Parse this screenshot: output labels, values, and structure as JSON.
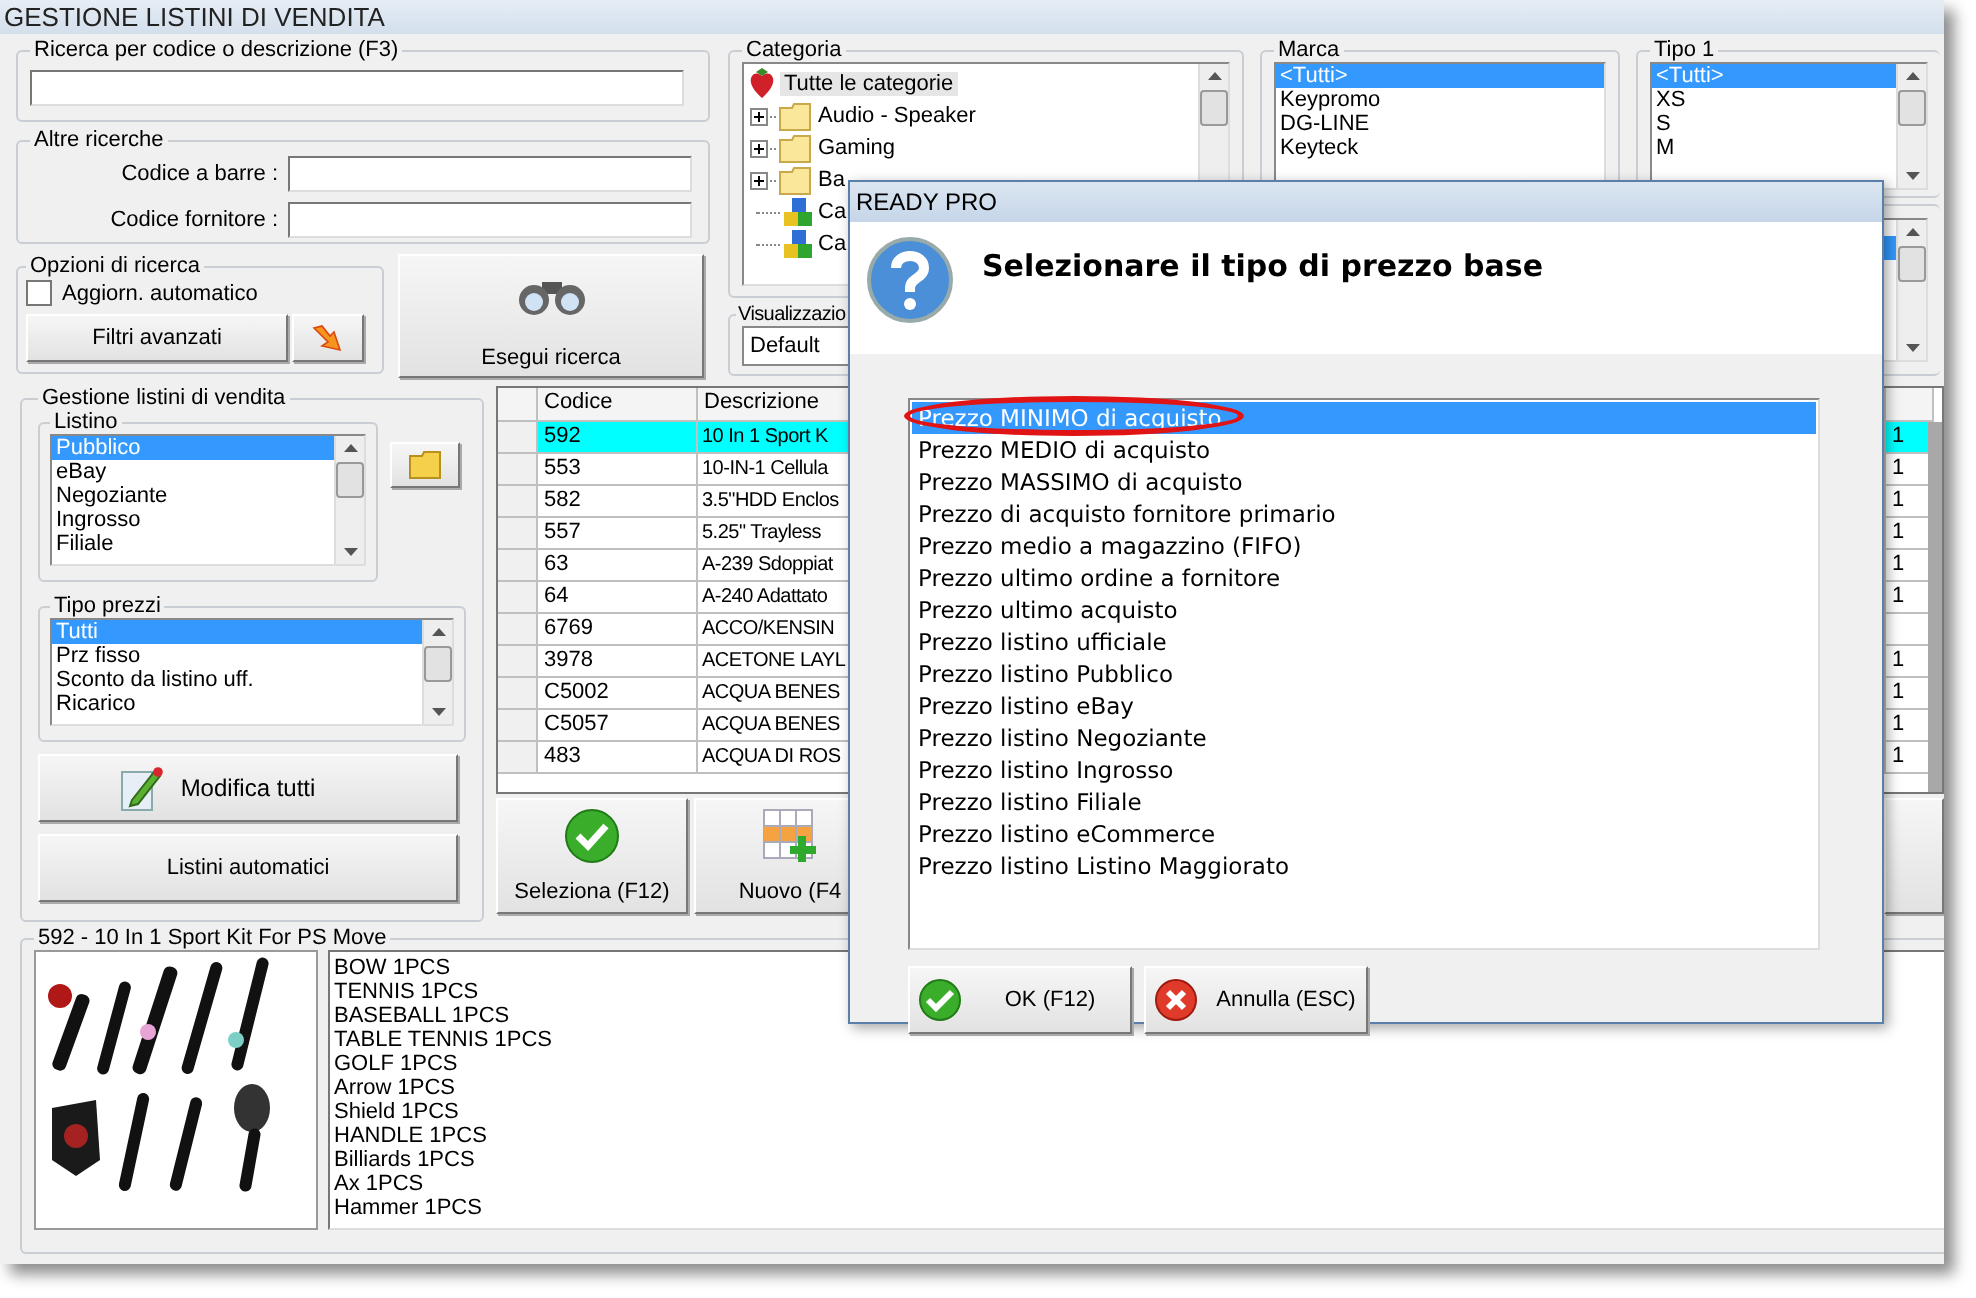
{
  "window": {
    "title": "GESTIONE LISTINI DI VENDITA"
  },
  "search": {
    "label": "Ricerca per codice o descrizione (F3)"
  },
  "other_searches": {
    "label": "Altre ricerche",
    "fields": [
      {
        "label": "Codice a barre :"
      },
      {
        "label": "Codice fornitore :"
      }
    ]
  },
  "search_options": {
    "label": "Opzioni di ricerca",
    "auto_update": {
      "label": "Aggiorn. automatico",
      "checked": false
    },
    "advanced_button": "Filtri avanzati"
  },
  "run_search_button": "Esegui ricerca",
  "category": {
    "label": "Categoria",
    "tree": [
      {
        "label": "Tutte le categorie",
        "kind": "root",
        "selected": true,
        "children": [
          {
            "label": "Audio - Speaker",
            "kind": "folder",
            "expanded": false,
            "selected": false
          },
          {
            "label": "Gaming",
            "kind": "folder",
            "expanded": false,
            "selected": false
          },
          {
            "label": "Ba",
            "kind": "folder",
            "expanded": false,
            "selected": false
          },
          {
            "label": "Ca",
            "kind": "cubes",
            "selected": false
          },
          {
            "label": "Ca",
            "kind": "cubes",
            "selected": false
          }
        ]
      }
    ]
  },
  "view": {
    "label": "Visualizzazio",
    "value": "Default"
  },
  "brand": {
    "label": "Marca",
    "items": [
      {
        "label": "<Tutti>",
        "selected": true
      },
      {
        "label": "Keypromo",
        "selected": false
      },
      {
        "label": "DG-LINE",
        "selected": false
      },
      {
        "label": "Keyteck",
        "selected": false
      }
    ]
  },
  "type_1": {
    "label": "Tipo 1",
    "items": [
      {
        "label": "<Tutti>",
        "selected": true
      },
      {
        "label": "XS",
        "selected": false
      },
      {
        "label": "S",
        "selected": false
      },
      {
        "label": "M",
        "selected": false
      }
    ]
  },
  "price_lists": {
    "label": "Gestione listini di vendita",
    "listino": {
      "label": "Listino",
      "items": [
        {
          "label": "Pubblico",
          "selected": true
        },
        {
          "label": "eBay",
          "selected": false
        },
        {
          "label": "Negoziante",
          "selected": false
        },
        {
          "label": "Ingrosso",
          "selected": false
        },
        {
          "label": "Filiale",
          "selected": false
        }
      ]
    },
    "price_types": {
      "label": "Tipo prezzi",
      "items": [
        {
          "label": "Tutti",
          "selected": true
        },
        {
          "label": "Prz fisso",
          "selected": false
        },
        {
          "label": "Sconto da listino uff.",
          "selected": false
        },
        {
          "label": "Ricarico",
          "selected": false
        }
      ]
    },
    "edit_all_button": "Modifica tutti",
    "auto_lists_button": "Listini automatici"
  },
  "table": {
    "columns": [
      "Codice",
      "Descrizione"
    ],
    "rows": [
      {
        "code": "592",
        "description": "10 In 1 Sport K",
        "column_4": "1",
        "selected": true
      },
      {
        "code": "553",
        "description": "10-IN-1 Cellula",
        "column_4": "1",
        "selected": false
      },
      {
        "code": "582",
        "description": "3.5\"HDD Enclos",
        "column_4": "1",
        "selected": false
      },
      {
        "code": "557",
        "description": "5.25\" Trayless",
        "column_4": "1",
        "selected": false
      },
      {
        "code": "63",
        "description": "A-239 Sdoppiat",
        "column_4": "1",
        "selected": false
      },
      {
        "code": "64",
        "description": "A-240 Adattato",
        "column_4": "1",
        "selected": false
      },
      {
        "code": "6769",
        "description": "ACCO/KENSIN",
        "column_4": "",
        "selected": false
      },
      {
        "code": "3978",
        "description": "ACETONE LAYL",
        "column_4": "1",
        "selected": false
      },
      {
        "code": "C5002",
        "description": "ACQUA BENES",
        "column_4": "1",
        "selected": false
      },
      {
        "code": "C5057",
        "description": "ACQUA BENES",
        "column_4": "1",
        "selected": false
      },
      {
        "code": "483",
        "description": "ACQUA DI ROS",
        "column_4": "1",
        "selected": false
      }
    ]
  },
  "buttons": [
    {
      "label": "Seleziona (F12)",
      "kind": "select"
    },
    {
      "label": "Nuovo (F4",
      "kind": "new"
    }
  ],
  "product": {
    "title": "592 - 10 In 1 Sport Kit For PS Move",
    "notes": [
      "BOW 1PCS",
      "TENNIS 1PCS",
      "BASEBALL 1PCS",
      "TABLE TENNIS 1PCS",
      "GOLF 1PCS",
      "Arrow 1PCS",
      "Shield 1PCS",
      "HANDLE 1PCS",
      "Billiards 1PCS",
      "Ax  1PCS",
      "Hammer 1PCS"
    ]
  },
  "dialog": {
    "title": "READY PRO",
    "message": "Selezionare il tipo di prezzo base",
    "options": [
      {
        "label": "Prezzo MINIMO di acquisto",
        "selected": true,
        "circled": true
      },
      {
        "label": "Prezzo MEDIO di acquisto",
        "selected": false,
        "circled": false
      },
      {
        "label": "Prezzo MASSIMO di acquisto",
        "selected": false,
        "circled": false
      },
      {
        "label": "Prezzo di acquisto fornitore primario",
        "selected": false,
        "circled": false
      },
      {
        "label": "Prezzo medio a magazzino (FIFO)",
        "selected": false,
        "circled": false
      },
      {
        "label": "Prezzo ultimo ordine a fornitore",
        "selected": false,
        "circled": false
      },
      {
        "label": "Prezzo ultimo acquisto",
        "selected": false,
        "circled": false
      },
      {
        "label": "Prezzo listino ufficiale",
        "selected": false,
        "circled": false
      },
      {
        "label": "Prezzo listino Pubblico",
        "selected": false,
        "circled": false
      },
      {
        "label": "Prezzo listino eBay",
        "selected": false,
        "circled": false
      },
      {
        "label": "Prezzo listino Negoziante",
        "selected": false,
        "circled": false
      },
      {
        "label": "Prezzo listino Ingrosso",
        "selected": false,
        "circled": false
      },
      {
        "label": "Prezzo listino Filiale",
        "selected": false,
        "circled": false
      },
      {
        "label": "Prezzo listino eCommerce",
        "selected": false,
        "circled": false
      },
      {
        "label": "Prezzo listino Listino Maggiorato",
        "selected": false,
        "circled": false
      }
    ],
    "buttons": [
      {
        "label": "OK (F12)",
        "kind": "ok"
      },
      {
        "label": "Annulla (ESC)",
        "kind": "cancel"
      }
    ]
  }
}
